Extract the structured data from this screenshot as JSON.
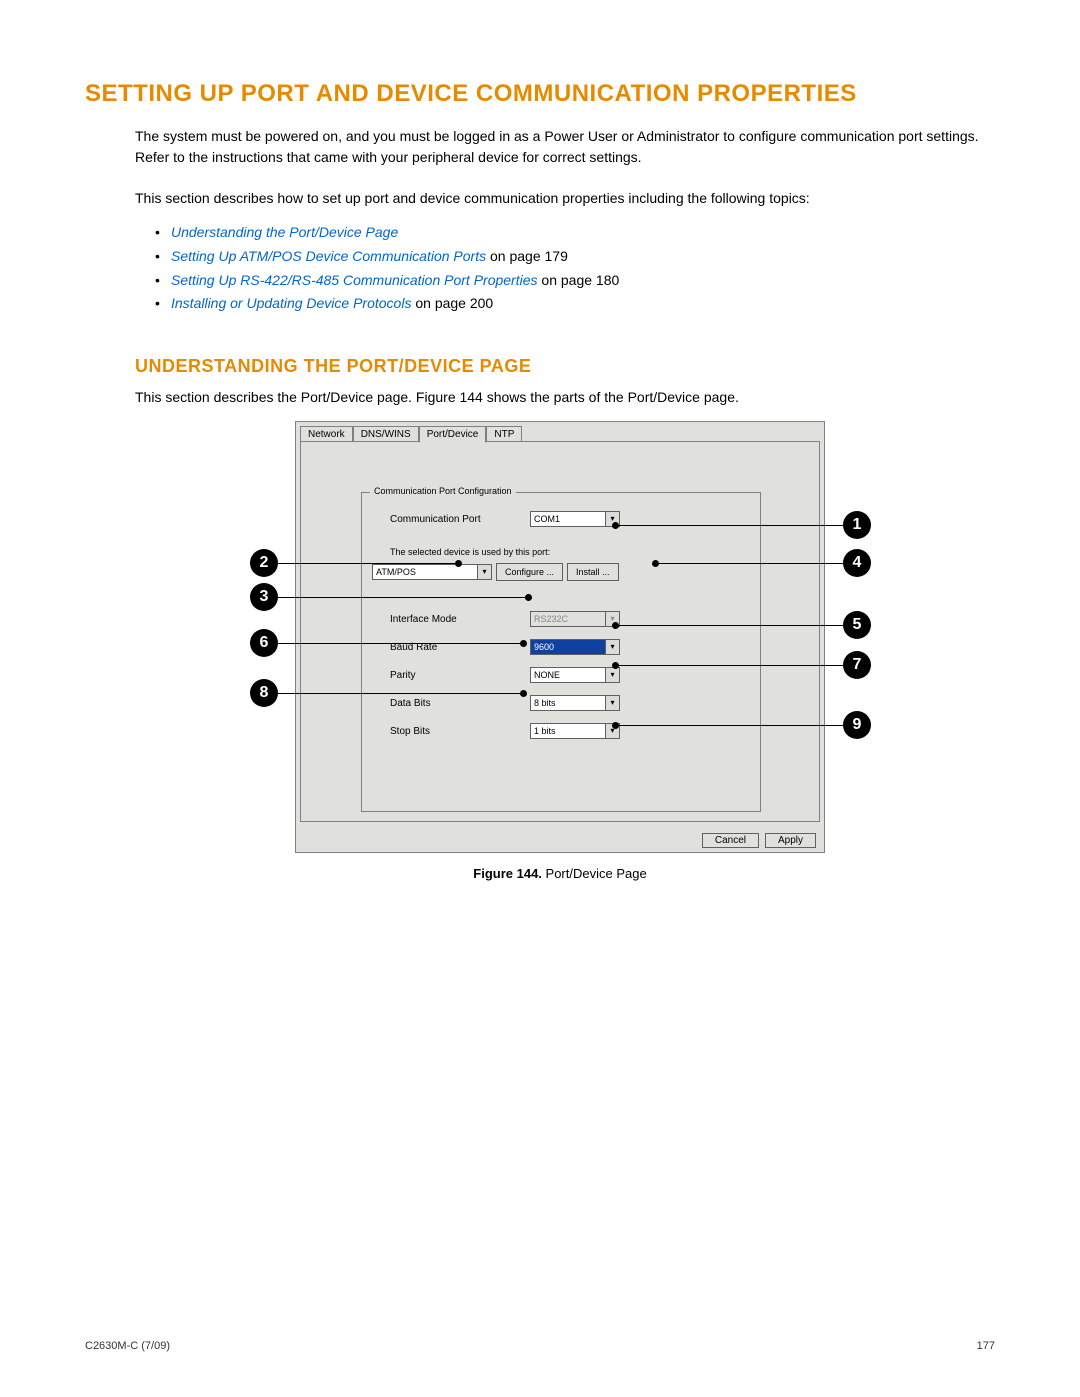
{
  "title": "SETTING UP PORT AND DEVICE COMMUNICATION PROPERTIES",
  "intro": "The system must be powered on, and you must be logged in as a Power User or Administrator to configure communication port settings. Refer to the instructions that came with your peripheral device for correct settings.",
  "intro2": "This section describes how to set up port and device communication properties including the following topics:",
  "links": [
    {
      "text": "Understanding the Port/Device Page",
      "after": ""
    },
    {
      "text": "Setting Up ATM/POS Device Communication Ports",
      "after": " on page 179"
    },
    {
      "text": "Setting Up RS-422/RS-485 Communication Port Properties",
      "after": " on page 180"
    },
    {
      "text": "Installing or Updating Device Protocols",
      "after": " on page 200"
    }
  ],
  "subheading": "UNDERSTANDING THE PORT/DEVICE PAGE",
  "subdesc": "This section describes the Port/Device page. Figure 144 shows the parts of the Port/Device page.",
  "dialog": {
    "tabs": [
      "Network",
      "DNS/WINS",
      "Port/Device",
      "NTP"
    ],
    "groupTitle": "Communication Port Configuration",
    "commPortLabel": "Communication Port",
    "commPortValue": "COM1",
    "deviceNote": "The selected device is used by this port:",
    "deviceValue": "ATM/POS",
    "configureBtn": "Configure ...",
    "installBtn": "Install ...",
    "rows": {
      "interfaceMode": {
        "label": "Interface Mode",
        "value": "RS232C"
      },
      "baudRate": {
        "label": "Baud Rate",
        "value": "9600"
      },
      "parity": {
        "label": "Parity",
        "value": "NONE"
      },
      "dataBits": {
        "label": "Data Bits",
        "value": "8 bits"
      },
      "stopBits": {
        "label": "Stop Bits",
        "value": "1 bits"
      }
    },
    "cancel": "Cancel",
    "apply": "Apply"
  },
  "figureCaptionBold": "Figure 144.",
  "figureCaptionRest": "  Port/Device Page",
  "callouts": [
    "1",
    "2",
    "3",
    "4",
    "5",
    "6",
    "7",
    "8",
    "9"
  ],
  "footerLeft": "C2630M-C (7/09)",
  "footerRight": "177"
}
